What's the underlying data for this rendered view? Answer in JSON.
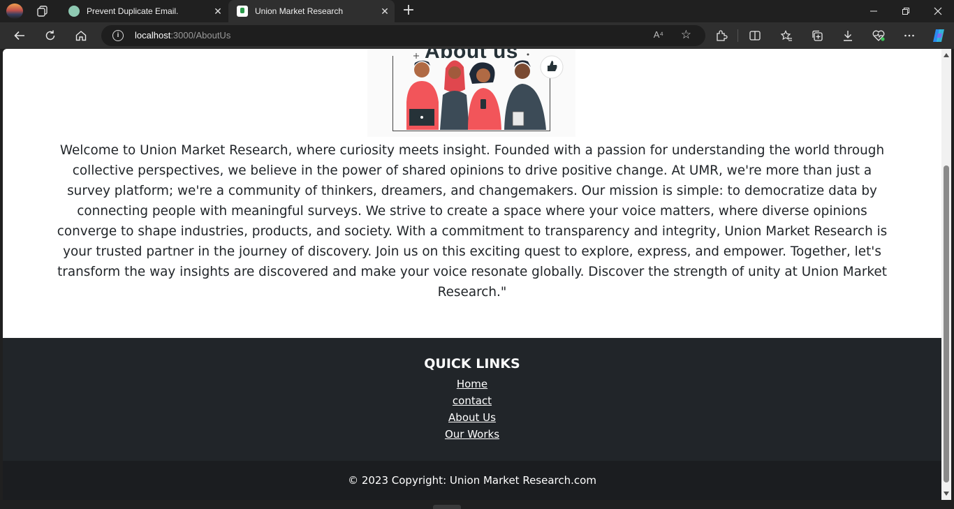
{
  "browser": {
    "tabs": [
      {
        "title": "Prevent Duplicate Email."
      },
      {
        "title": "Union Market Research"
      }
    ],
    "address": {
      "host": "localhost",
      "rest": ":3000/AboutUs"
    },
    "read_aloud_glyph": "A⁴"
  },
  "icons": {
    "back": "arrow-left-icon",
    "refresh": "refresh-icon",
    "home": "home-icon",
    "info": "info-icon",
    "favorite": "star-icon",
    "extensions": "puzzle-icon",
    "split": "split-screen-icon",
    "favorites": "favorites-icon",
    "collections": "collections-icon",
    "downloads": "download-icon",
    "health": "browser-essentials-icon",
    "more": "more-icon",
    "copilot": "copilot-icon"
  },
  "page": {
    "hero_title": "About us",
    "about_text": "Welcome to Union Market Research, where curiosity meets insight. Founded with a passion for understanding the world through collective perspectives, we believe in the power of shared opinions to drive positive change. At UMR, we're more than just a survey platform; we're a community of thinkers, dreamers, and changemakers. Our mission is simple: to democratize data by connecting people with meaningful surveys. We strive to create a space where your voice matters, where diverse opinions converge to shape industries, products, and society. With a commitment to transparency and integrity, Union Market Research is your trusted partner in the journey of discovery. Join us on this exciting quest to explore, express, and empower. Together, let's transform the way insights are discovered and make your voice resonate globally. Discover the strength of unity at Union Market Research.\"",
    "footer": {
      "heading": "QUICK LINKS",
      "links": [
        "Home",
        "contact",
        "About Us",
        "Our Works"
      ],
      "copyright": "© 2023 Copyright: Union Market Research.com"
    }
  },
  "colors": {
    "footer_bg": "#212529",
    "copyright_bg": "#1b1d20",
    "illustration_accent": "#f2555a"
  }
}
